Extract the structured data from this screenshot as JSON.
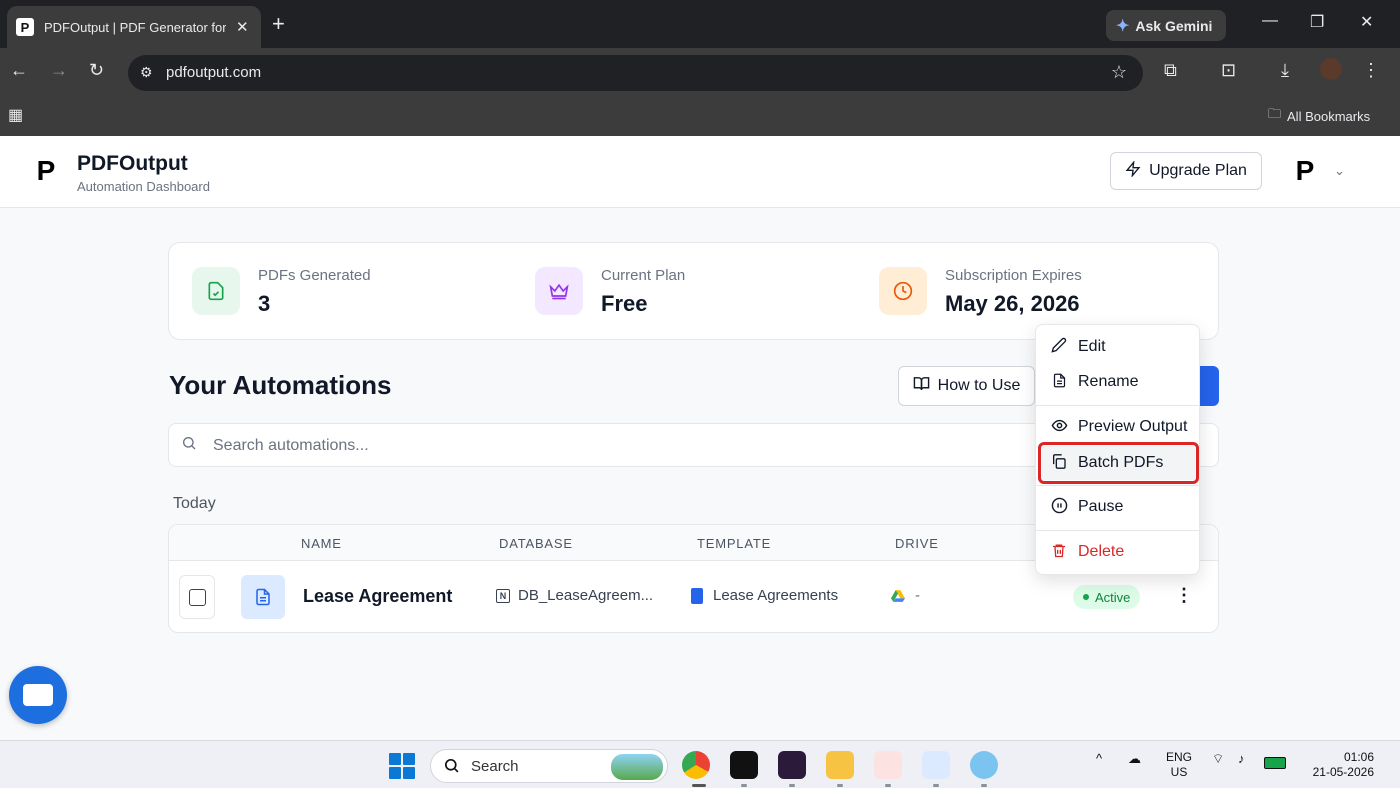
{
  "browser": {
    "tab_title": "PDFOutput | PDF Generator for",
    "tab_favicon": "P",
    "new_tab": "+",
    "gemini_label": "Ask Gemini",
    "url": "pdfoutput.com",
    "bookmarks_label": "All Bookmarks"
  },
  "header": {
    "logo": "P",
    "brand": "PDFOutput",
    "subtitle": "Automation Dashboard",
    "upgrade_label": "Upgrade Plan",
    "avatar": "P"
  },
  "stats": [
    {
      "label": "PDFs Generated",
      "value": "3",
      "icon": "file-check-icon",
      "bg": "#e8f7ee",
      "fg": "#16a34a"
    },
    {
      "label": "Current Plan",
      "value": "Free",
      "icon": "crown-icon",
      "bg": "#f3e8ff",
      "fg": "#9333ea"
    },
    {
      "label": "Subscription Expires",
      "value": "May 26, 2026",
      "icon": "clock-icon",
      "bg": "#ffedd5",
      "fg": "#ea580c"
    }
  ],
  "automations": {
    "title": "Your Automations",
    "how_to_label": "How to Use",
    "search_placeholder": "Search automations...",
    "group_label": "Today",
    "columns": [
      "NAME",
      "DATABASE",
      "TEMPLATE",
      "DRIVE"
    ],
    "rows": [
      {
        "name": "Lease Agreement",
        "database": "DB_LeaseAgreem...",
        "template": "Lease Agreements",
        "drive": "-",
        "status": "Active"
      }
    ]
  },
  "menu": {
    "items": [
      {
        "label": "Edit",
        "icon": "pencil-icon"
      },
      {
        "label": "Rename",
        "icon": "file-text-icon"
      },
      {
        "label": "Preview Output",
        "icon": "eye-icon"
      },
      {
        "label": "Batch PDFs",
        "icon": "copy-icon"
      },
      {
        "label": "Pause",
        "icon": "pause-circle-icon"
      },
      {
        "label": "Delete",
        "icon": "trash-icon"
      }
    ]
  },
  "taskbar": {
    "search_label": "Search",
    "lang_line1": "ENG",
    "lang_line2": "US",
    "time": "01:06",
    "date": "21-05-2026"
  },
  "colors": {
    "accent": "#2563eb",
    "status_active": "#15803d",
    "danger": "#dc2626",
    "highlight_box": "#dc2626"
  }
}
